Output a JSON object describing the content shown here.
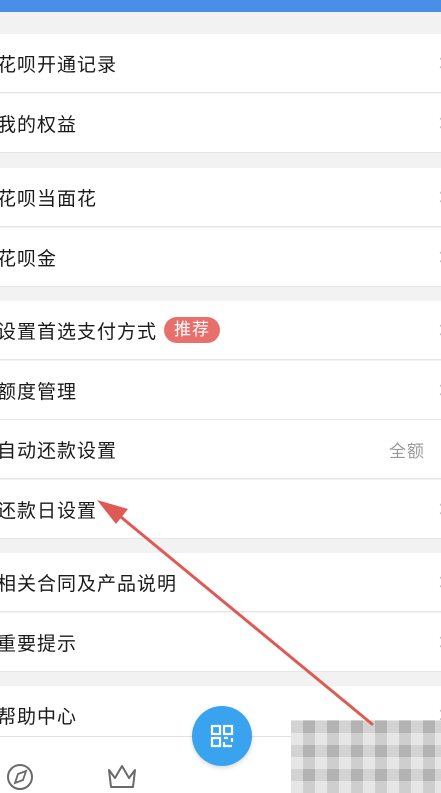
{
  "colors": {
    "top_bar": "#4a8fe7",
    "badge_bg": "#e7706c",
    "scan_button": "#3aa3f0",
    "annotation_arrow": "#e05a55"
  },
  "groups": [
    {
      "items": [
        {
          "label": "花呗开通记录"
        },
        {
          "label": "我的权益"
        }
      ]
    },
    {
      "items": [
        {
          "label": "花呗当面花"
        },
        {
          "label": "花呗金"
        }
      ]
    },
    {
      "items": [
        {
          "label": "设置首选支付方式",
          "badge": "推荐"
        },
        {
          "label": "额度管理"
        },
        {
          "label": "自动还款设置",
          "value": "全额"
        },
        {
          "label": "还款日设置"
        }
      ]
    },
    {
      "items": [
        {
          "label": "相关合同及产品说明"
        },
        {
          "label": "重要提示"
        }
      ]
    },
    {
      "items": [
        {
          "label": "帮助中心"
        }
      ]
    }
  ],
  "tabbar": {
    "icons": [
      "compass-icon",
      "crown-icon",
      "scan-icon"
    ]
  }
}
